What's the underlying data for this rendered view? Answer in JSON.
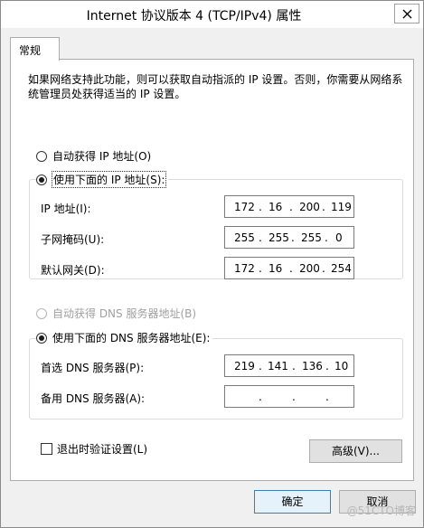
{
  "window": {
    "title": "Internet 协议版本 4 (TCP/IPv4) 属性"
  },
  "tab": {
    "label": "常规"
  },
  "description": "如果网络支持此功能，则可以获取自动指派的 IP 设置。否则，你需要从网络系统管理员处获得适当的 IP 设置。",
  "ip_section": {
    "auto_label": "自动获得 IP 地址(O)",
    "manual_label": "使用下面的 IP 地址(S):",
    "selected": "manual",
    "fields": [
      {
        "label": "IP 地址(I):",
        "octets": [
          "172",
          "16",
          "200",
          "119"
        ]
      },
      {
        "label": "子网掩码(U):",
        "octets": [
          "255",
          "255",
          "255",
          "0"
        ]
      },
      {
        "label": "默认网关(D):",
        "octets": [
          "172",
          "16",
          "200",
          "254"
        ]
      }
    ]
  },
  "dns_section": {
    "auto_label": "自动获得 DNS 服务器地址(B)",
    "manual_label": "使用下面的 DNS 服务器地址(E):",
    "selected": "manual",
    "fields": [
      {
        "label": "首选 DNS 服务器(P):",
        "octets": [
          "219",
          "141",
          "136",
          "10"
        ]
      },
      {
        "label": "备用 DNS 服务器(A):",
        "octets": [
          "",
          "",
          "",
          ""
        ]
      }
    ]
  },
  "validate_on_exit": {
    "label": "退出时验证设置(L)",
    "checked": false
  },
  "buttons": {
    "advanced": "高级(V)...",
    "ok": "确定",
    "cancel": "取消"
  },
  "watermark": "@51CTO博客"
}
